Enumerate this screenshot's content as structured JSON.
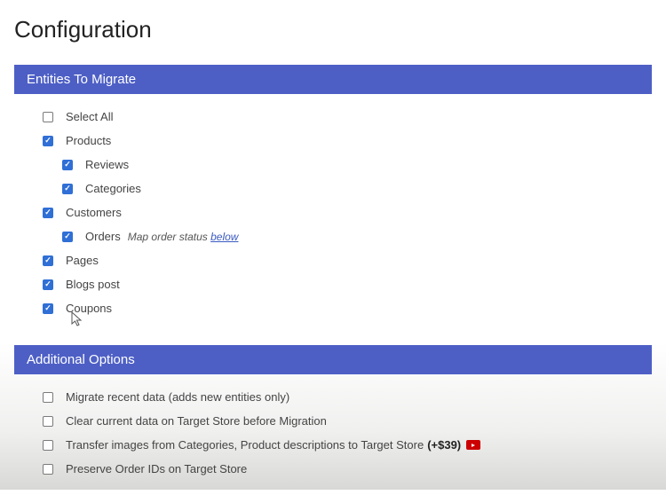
{
  "pageTitle": "Configuration",
  "sections": {
    "entities": {
      "header": "Entities To Migrate",
      "items": {
        "selectAll": {
          "label": "Select All",
          "checked": false
        },
        "products": {
          "label": "Products",
          "checked": true
        },
        "reviews": {
          "label": "Reviews",
          "checked": true
        },
        "categories": {
          "label": "Categories",
          "checked": true
        },
        "customers": {
          "label": "Customers",
          "checked": true
        },
        "orders": {
          "label": "Orders",
          "checked": true,
          "hintPrefix": "Map order status ",
          "hintLink": "below"
        },
        "pages": {
          "label": "Pages",
          "checked": true
        },
        "blogsPost": {
          "label": "Blogs post",
          "checked": true
        },
        "coupons": {
          "label": "Coupons",
          "checked": true
        }
      }
    },
    "additionalOptions": {
      "header": "Additional Options",
      "items": {
        "migrateRecent": {
          "label": "Migrate recent data (adds new entities only)",
          "checked": false
        },
        "clearCurrent": {
          "label": "Clear current data on Target Store before Migration",
          "checked": false
        },
        "transferImages": {
          "label": "Transfer images from Categories, Product descriptions to Target Store",
          "price": "(+$39)",
          "checked": false,
          "hasVideo": true
        },
        "preserveOrderIds": {
          "label": "Preserve Order IDs on Target Store",
          "checked": false
        }
      }
    }
  }
}
